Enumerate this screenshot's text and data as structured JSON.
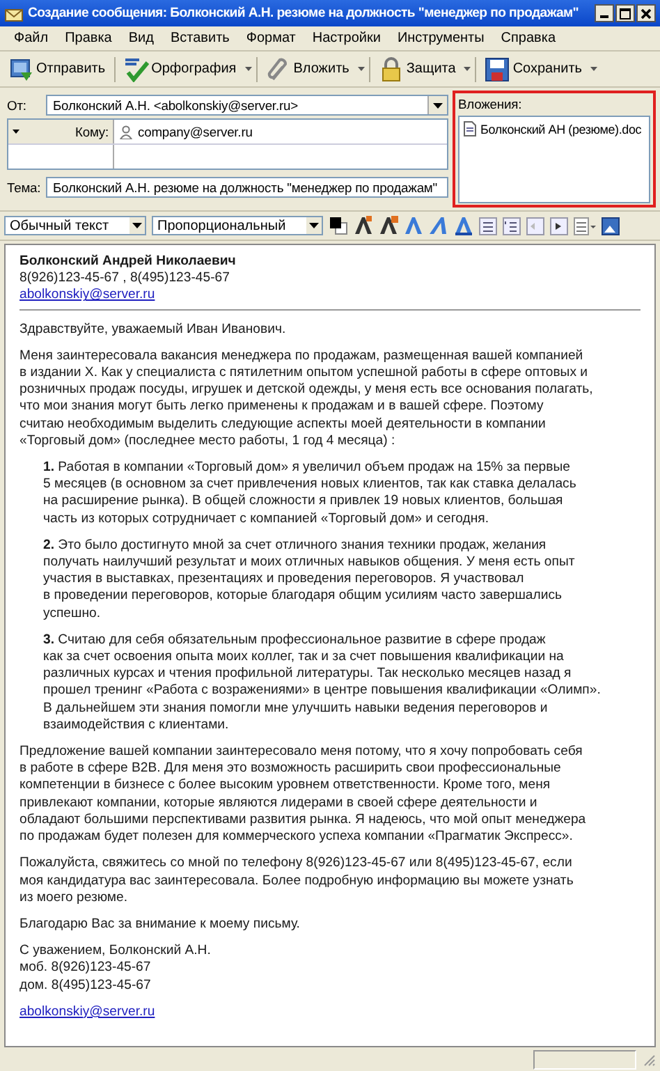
{
  "window": {
    "title": "Создание сообщения: Болконский А.Н. резюме на должность \"менеджер по продажам\""
  },
  "menu": [
    "Файл",
    "Правка",
    "Вид",
    "Вставить",
    "Формат",
    "Настройки",
    "Инструменты",
    "Справка"
  ],
  "toolbar": [
    {
      "label": "Отправить",
      "kind": "send",
      "dropdown": false
    },
    {
      "label": "Орфография",
      "kind": "spell",
      "dropdown": true
    },
    {
      "label": "Вложить",
      "kind": "attach",
      "dropdown": true
    },
    {
      "label": "Защита",
      "kind": "lock",
      "dropdown": true
    },
    {
      "label": "Сохранить",
      "kind": "save",
      "dropdown": true
    }
  ],
  "header": {
    "from_label": "От:",
    "from": "Болконский А.Н.  <abolkonskiy@server.ru>",
    "recipients": [
      {
        "type": "Кому:",
        "address": "company@server.ru"
      }
    ],
    "subject_label": "Тема:",
    "subject": "Болконский А.Н. резюме на должность \"менеджер по продажам\""
  },
  "attachments": {
    "label": "Вложения:",
    "highlighted": true,
    "files": [
      "Болконский АН (резюме).doc"
    ]
  },
  "format_bar": {
    "paragraph_style": "Обычный текст",
    "font": "Пропорциональный"
  },
  "body": {
    "sender_name": "Болконский Андрей Николаевич",
    "sender_phones": "8(926)123-45-67 , 8(495)123-45-67",
    "sender_email": "abolkonskiy@server.ru",
    "blocks": [
      {
        "kind": "para",
        "text": "Здравствуйте, уважаемый Иван Иванович."
      },
      {
        "kind": "para",
        "text": "Меня заинтересовала вакансия менеджера по продажам, размещенная вашей компанией\nв издании Х. Как у специалиста с пятилетним опытом успешной работы в сфере оптовых и\nрозничных продаж посуды, игрушек и детской одежды, у меня есть все основания полагать,\nчто мои знания могут быть легко применены к продажам и в вашей сфере. Поэтому\nсчитаю необходимым выделить следующие аспекты моей деятельности в компании\n«Торговый дом» (последнее место работы, 1 год 4 месяца) :"
      },
      {
        "kind": "item",
        "text": "**1.** Работая в компании «Торговый дом» я увеличил объем продаж на 15% за первые\n5 месяцев (в основном за счет привлечения новых клиентов, так как ставка делалась\nна расширение рынка). В общей сложности я привлек 19 новых клиентов, большая\nчасть из которых сотрудничает с компанией «Торговый дом» и сегодня."
      },
      {
        "kind": "item",
        "text": "**2.** Это было достигнуто мной за счет отличного знания техники продаж, желания\nполучать наилучший результат и моих отличных навыков общения. У меня есть опыт\nучастия в выставках, презентациях и проведения переговоров. Я участвовал\nв проведении переговоров, которые благодаря общим усилиям часто завершались\nуспешно."
      },
      {
        "kind": "item",
        "text": "**3.** Считаю для себя обязательным профессиональное развитие в сфере продаж\nкак за счет освоения опыта моих коллег, так и за счет повышения квалификации на\nразличных курсах и чтения профильной литературы. Так несколько месяцев назад я\nпрошел тренинг «Работа с возражениями»  в центре повышения квалификации «Олимп».\nВ дальнейшем эти знания помогли мне улучшить навыки ведения переговоров и\nвзаимодействия с клиентами."
      },
      {
        "kind": "para",
        "text": "Предложение вашей компании заинтересовало меня потому, что я хочу попробовать себя\nв работе в сфере B2B. Для меня это возможность расширить свои профессиональные\nкомпетенции в бизнесе с более высоким уровнем ответственности. Кроме того, меня\nпривлекают компании, которые являются лидерами в своей сфере деятельности и\nобладают большими перспективами развития рынка. Я надеюсь, что мой опыт менеджера\nпо продажам будет полезен для коммерческого успеха компании «Прагматик Экспресс»."
      },
      {
        "kind": "para",
        "text": "Пожалуйста, свяжитесь со мной по телефону 8(926)123-45-67 или 8(495)123-45-67, если\nмоя кандидатура вас заинтересовала. Более подробную информацию вы можете узнать\nиз моего резюме."
      },
      {
        "kind": "para",
        "text": "Благодарю Вас за внимание к моему письму."
      },
      {
        "kind": "para",
        "text": "С уважением, Болконский А.Н.\nмоб. 8(926)123-45-67\nдом. 8(495)123-45-67"
      },
      {
        "kind": "link",
        "text": "abolkonskiy@server.ru"
      }
    ]
  }
}
